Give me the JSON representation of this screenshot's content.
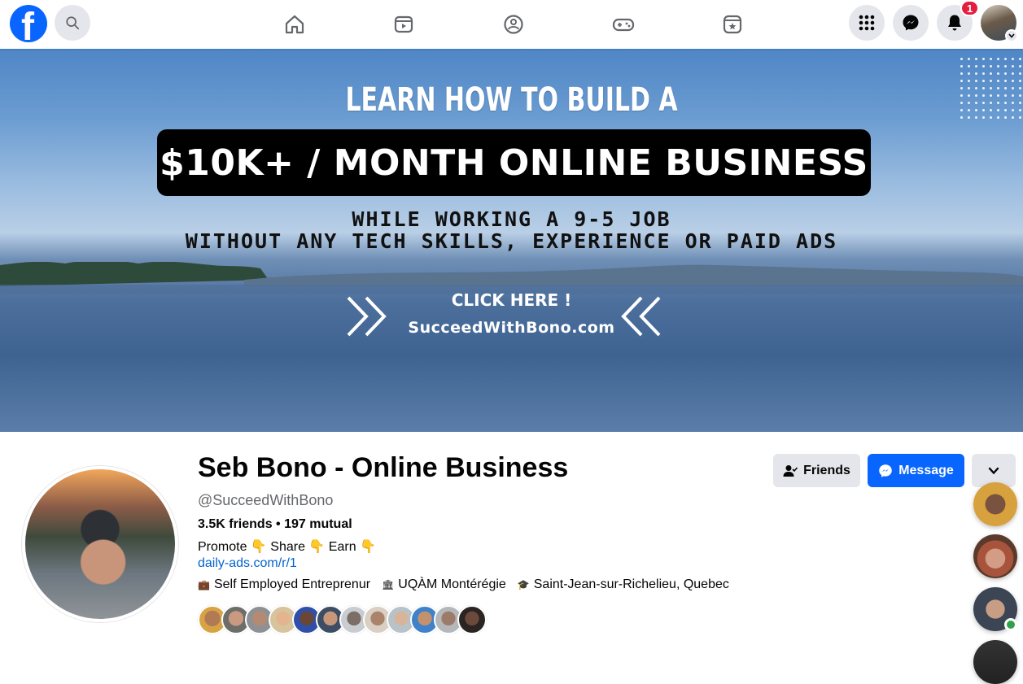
{
  "nav": {
    "logo_letter": "f",
    "notification_count": "1"
  },
  "cover": {
    "line1": "LEARN HOW TO BUILD A",
    "line2": "$10K+ / MONTH ONLINE BUSINESS",
    "line3": "WHILE WORKING A 9-5 JOB",
    "line4": "WITHOUT ANY TECH SKILLS, EXPERIENCE OR PAID ADS",
    "cta": "CLICK HERE !",
    "site": "SucceedWithBono.com"
  },
  "profile": {
    "name": "Seb Bono - Online Business",
    "handle": "@SucceedWithBono",
    "friends": "3.5K friends • 197 mutual",
    "bio": "Promote 👇 Share 👇 Earn 👇",
    "link": "daily-ads.com/r/1",
    "details": [
      {
        "icon": "briefcase-icon",
        "glyph": "💼",
        "text": "Self Employed Entreprenur"
      },
      {
        "icon": "school-icon",
        "glyph": "🏛",
        "text": "UQÀM Montérégie"
      },
      {
        "icon": "graduation-cap-icon",
        "glyph": "🎓",
        "text": "Saint-Jean-sur-Richelieu, Quebec"
      }
    ]
  },
  "actions": {
    "friends_label": "Friends",
    "message_label": "Message"
  },
  "colors": {
    "brand_blue": "#0866ff",
    "button_gray": "#e4e6eb",
    "link_blue": "#0064d1",
    "notification_red": "#e41e3f",
    "online_green": "#31a24c"
  }
}
